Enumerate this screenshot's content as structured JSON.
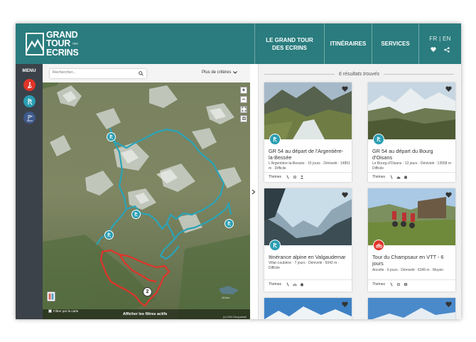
{
  "header": {
    "logo": {
      "line1": "GRAND",
      "line2": "TOUR",
      "line2_small": "DES",
      "line3": "ECRINS"
    },
    "nav": [
      {
        "label": "LE GRAND TOUR DES ECRINS"
      },
      {
        "label": "ITINÉRAIRES"
      },
      {
        "label": "SERVICES"
      }
    ],
    "languages": {
      "fr": "FR",
      "sep": "|",
      "en": "EN"
    }
  },
  "sidebar": {
    "menu_label": "MENU",
    "buttons": [
      {
        "icon": "hiker-icon",
        "color": "#e0342a"
      },
      {
        "icon": "trekking-icon",
        "color": "#2a9eb3"
      },
      {
        "icon": "flag-icon",
        "color": "#3e5a8c"
      }
    ]
  },
  "map": {
    "search_placeholder": "Rechercher...",
    "criteria_label": "Plus de critères",
    "filter_label": "Filtrer par la carte",
    "active_filters_label": "Afficher les filtres actifs",
    "credit": "(c) IGN Geoportail",
    "scale": "10 km",
    "cluster_count": "2",
    "colors": {
      "route_blue": "#2aa4b8",
      "route_red": "#e0342a"
    }
  },
  "results": {
    "count_text": "6 résultats trouvés",
    "themes_label": "Thèmes",
    "cards": [
      {
        "title": "GR 54 au départ de l'Argentière-la-Bessée",
        "meta": "L'Argentière-la-Bessée · 15 jours · Dénivelé : 14851 m · Difficile",
        "badge_color": "#2a9eb3",
        "badge_icon": "trekking-icon"
      },
      {
        "title": "GR 54 au départ du Bourg d'Oisans",
        "meta": "Le Bourg-d'Oisans · 13 jours · Dénivelé : 13558 m · Difficile",
        "badge_color": "#2a9eb3",
        "badge_icon": "trekking-icon"
      },
      {
        "title": "Itinérance alpine en Valgaudemar",
        "meta": "Villar-Loubière · 7 jours · Dénivelé : 6042 m · Difficile",
        "badge_color": "#2a9eb3",
        "badge_icon": "trekking-icon"
      },
      {
        "title": "Tour du Champsaur en VTT - 6 jours",
        "meta": "Ancelle · 6 jours · Dénivelé : 6349 m · Moyen",
        "badge_color": "#e0342a",
        "badge_icon": "bike-icon"
      }
    ]
  }
}
